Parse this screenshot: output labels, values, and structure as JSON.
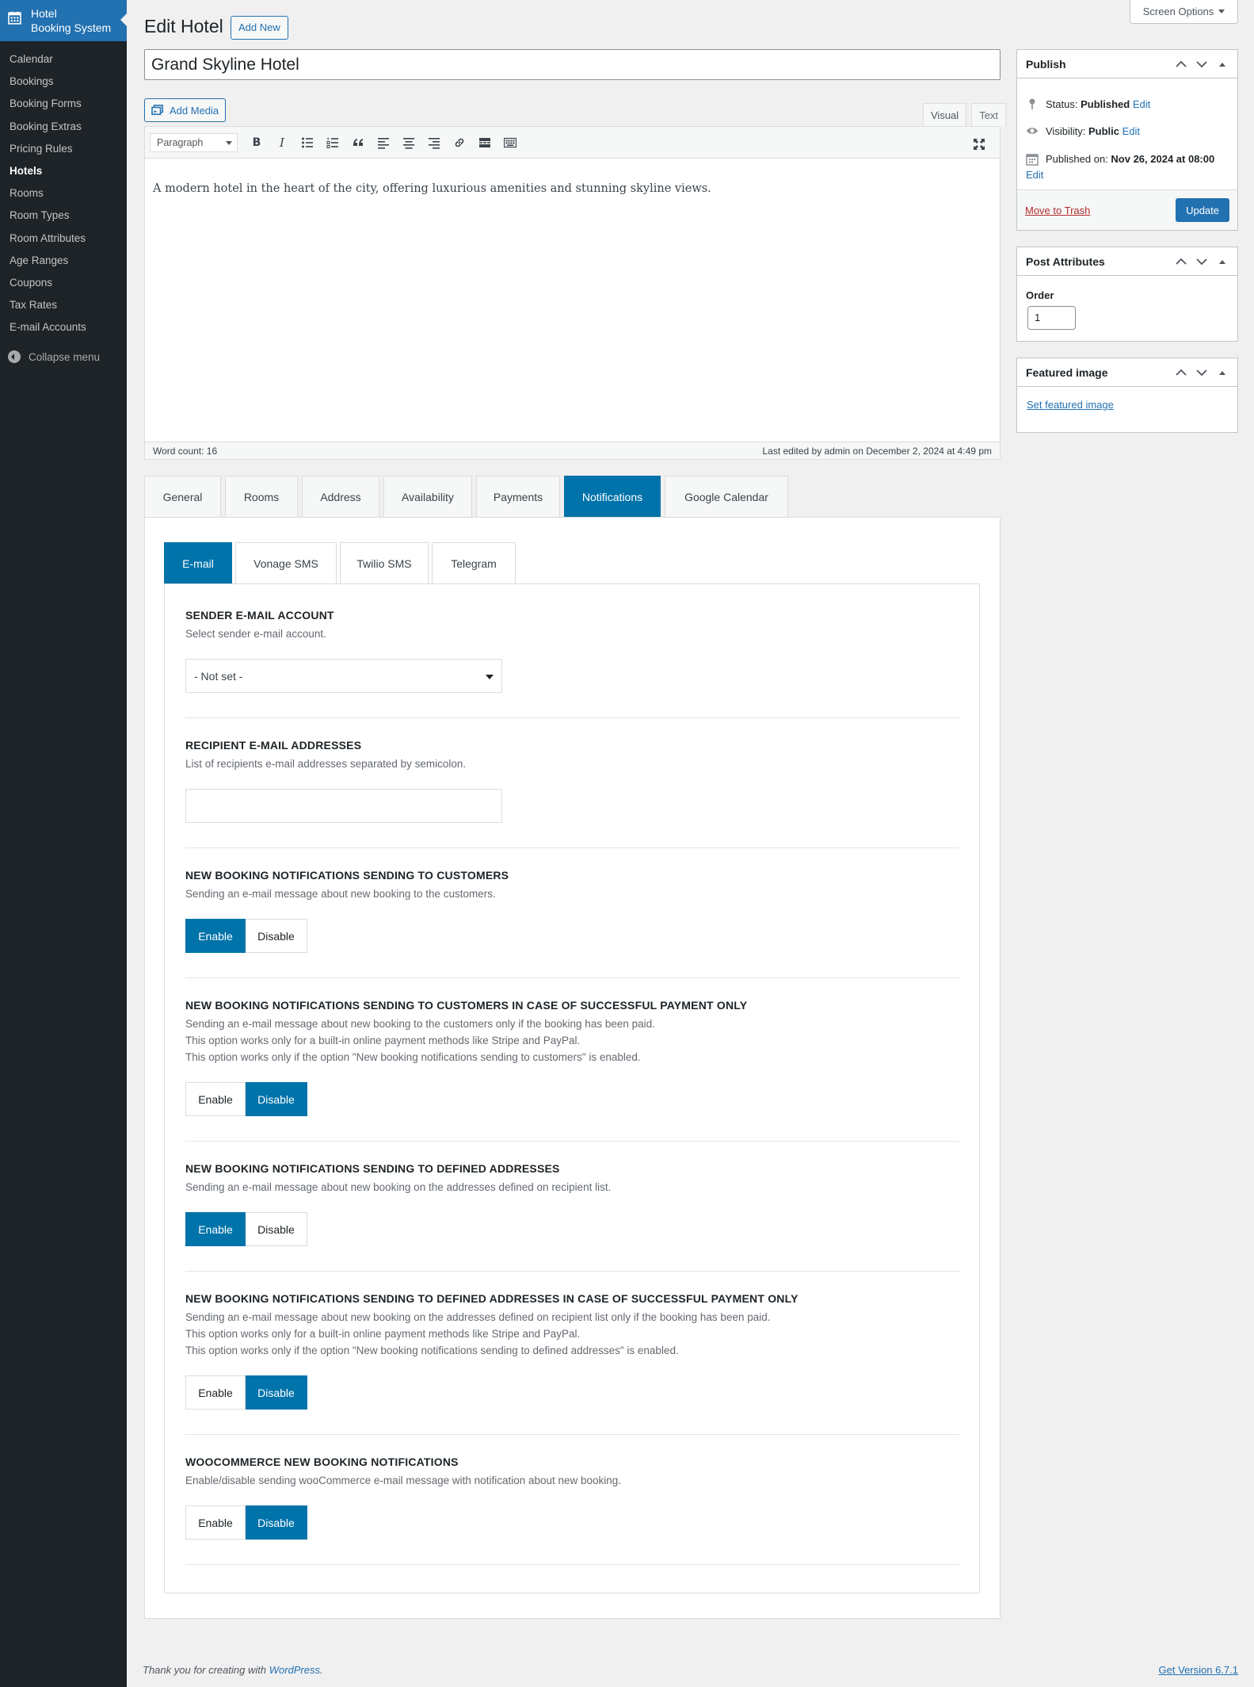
{
  "sidebar": {
    "brand": "Hotel Booking System",
    "brand_line1": "Hotel",
    "brand_line2": "Booking System",
    "items": [
      {
        "label": "Calendar"
      },
      {
        "label": "Bookings"
      },
      {
        "label": "Booking Forms"
      },
      {
        "label": "Booking Extras"
      },
      {
        "label": "Pricing Rules"
      },
      {
        "label": "Hotels",
        "current": true
      },
      {
        "label": "Rooms"
      },
      {
        "label": "Room Types"
      },
      {
        "label": "Room Attributes"
      },
      {
        "label": "Age Ranges"
      },
      {
        "label": "Coupons"
      },
      {
        "label": "Tax Rates"
      },
      {
        "label": "E-mail Accounts"
      }
    ],
    "collapse_label": "Collapse menu"
  },
  "header": {
    "screen_options": "Screen Options",
    "page_title": "Edit Hotel",
    "add_new": "Add New"
  },
  "post": {
    "title": "Grand Skyline Hotel"
  },
  "editor": {
    "add_media": "Add Media",
    "tab_visual": "Visual",
    "tab_text": "Text",
    "format": "Paragraph",
    "content": "A modern hotel in the heart of the city, offering luxurious amenities and stunning skyline views.",
    "word_count": "Word count: 16",
    "last_edited": "Last edited by admin on December 2, 2024 at 4:49 pm"
  },
  "main_tabs": [
    {
      "label": "General"
    },
    {
      "label": "Rooms"
    },
    {
      "label": "Address"
    },
    {
      "label": "Availability"
    },
    {
      "label": "Payments"
    },
    {
      "label": "Notifications",
      "active": true
    },
    {
      "label": "Google Calendar"
    }
  ],
  "sub_tabs": [
    {
      "label": "E-mail",
      "active": true
    },
    {
      "label": "Vonage SMS"
    },
    {
      "label": "Twilio SMS"
    },
    {
      "label": "Telegram"
    }
  ],
  "sections": {
    "sender": {
      "title": "SENDER E-MAIL ACCOUNT",
      "desc": "Select sender e-mail account.",
      "value": "- Not set -"
    },
    "recipients": {
      "title": "RECIPIENT E-MAIL ADDRESSES",
      "desc": "List of recipients e-mail addresses separated by semicolon.",
      "value": ""
    },
    "customers": {
      "title": "NEW BOOKING NOTIFICATIONS SENDING TO CUSTOMERS",
      "desc": "Sending an e-mail message about new booking to the customers.",
      "selected": "Enable"
    },
    "customers_paid": {
      "title": "NEW BOOKING NOTIFICATIONS SENDING TO CUSTOMERS IN CASE OF SUCCESSFUL PAYMENT ONLY",
      "desc1": "Sending an e-mail message about new booking to the customers only if the booking has been paid.",
      "desc2": "This option works only for a built-in online payment methods like Stripe and PayPal.",
      "desc3": "This option works only if the option \"New booking notifications sending to customers\" is enabled.",
      "selected": "Disable"
    },
    "defined": {
      "title": "NEW BOOKING NOTIFICATIONS SENDING TO DEFINED ADDRESSES",
      "desc": "Sending an e-mail message about new booking on the addresses defined on recipient list.",
      "selected": "Enable"
    },
    "defined_paid": {
      "title": "NEW BOOKING NOTIFICATIONS SENDING TO DEFINED ADDRESSES IN CASE OF SUCCESSFUL PAYMENT ONLY",
      "desc1": "Sending an e-mail message about new booking on the addresses defined on recipient list only if the booking has been paid.",
      "desc2": "This option works only for a built-in online payment methods like Stripe and PayPal.",
      "desc3": "This option works only if the option \"New booking notifications sending to defined addresses\" is enabled.",
      "selected": "Disable"
    },
    "woocommerce": {
      "title": "WOOCOMMERCE NEW BOOKING NOTIFICATIONS",
      "desc": "Enable/disable sending wooCommerce e-mail message with notification about new booking.",
      "selected": "Disable"
    },
    "enable_label": "Enable",
    "disable_label": "Disable"
  },
  "publish_box": {
    "title": "Publish",
    "status_label": "Status:",
    "status_value": "Published",
    "visibility_label": "Visibility:",
    "visibility_value": "Public",
    "published_label": "Published on:",
    "published_value": "Nov 26, 2024 at 08:00",
    "edit_link": "Edit",
    "trash": "Move to Trash",
    "update": "Update"
  },
  "attributes_box": {
    "title": "Post Attributes",
    "order_label": "Order",
    "order_value": "1"
  },
  "featured_box": {
    "title": "Featured image",
    "link": "Set featured image"
  },
  "footer": {
    "thanks_prefix": "Thank you for creating with ",
    "thanks_link": "WordPress",
    "thanks_suffix": ".",
    "version": "Get Version 6.7.1"
  },
  "colors": {
    "accent": "#0073aa",
    "wp_blue": "#2271b1",
    "sidebar_bg": "#1d2327",
    "trash_red": "#b32d2e"
  }
}
